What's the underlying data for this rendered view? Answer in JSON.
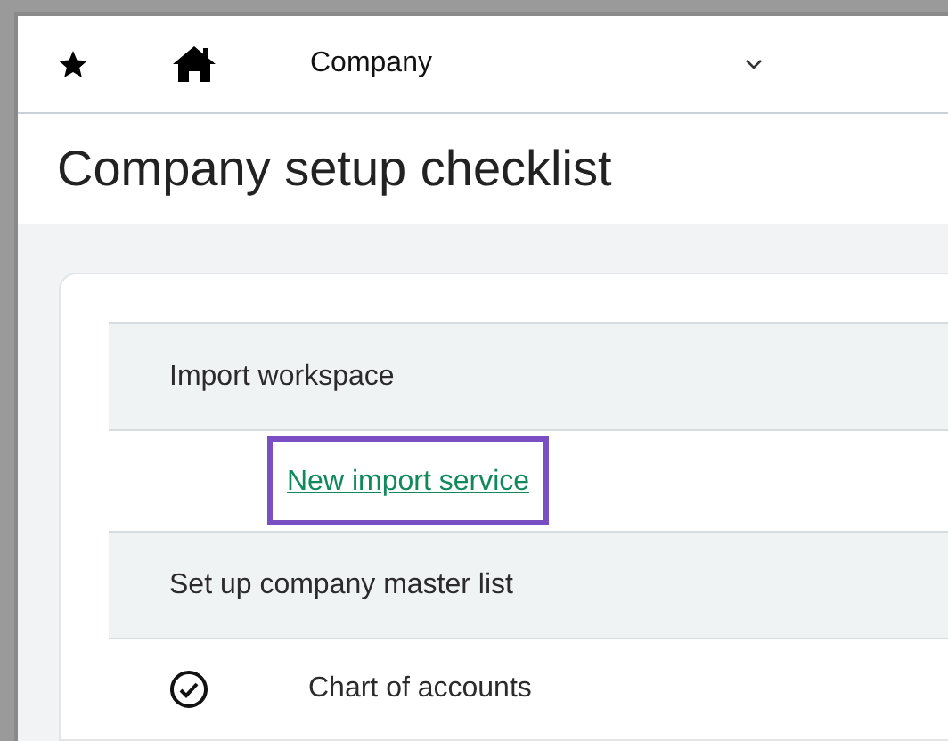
{
  "nav": {
    "module": "Company"
  },
  "page": {
    "title": "Company setup checklist"
  },
  "checklist": [
    {
      "kind": "section",
      "label": "Import workspace"
    },
    {
      "kind": "link",
      "label": "New import service",
      "focused": true
    },
    {
      "kind": "section",
      "label": "Set up company master list"
    },
    {
      "kind": "task",
      "label": "Chart of accounts",
      "completed": true
    }
  ]
}
